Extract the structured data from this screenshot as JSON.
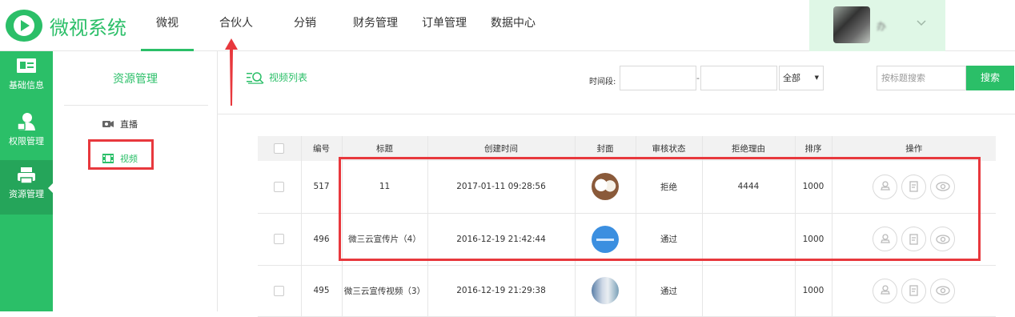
{
  "app": {
    "title": "微视系统"
  },
  "topnav": {
    "items": [
      "微视",
      "合伙人",
      "分销",
      "财务管理",
      "订单管理",
      "数据中心"
    ],
    "active_index": 0
  },
  "user": {
    "name": "办"
  },
  "sidebar": {
    "items": [
      {
        "label": "基础信息",
        "icon": "id-card-icon"
      },
      {
        "label": "权限管理",
        "icon": "user-lock-icon"
      },
      {
        "label": "资源管理",
        "icon": "printer-icon"
      }
    ],
    "active_index": 2
  },
  "subnav": {
    "title": "资源管理",
    "items": [
      {
        "label": "直播",
        "icon": "camera-icon"
      },
      {
        "label": "视频",
        "icon": "film-icon"
      }
    ],
    "active_index": 1
  },
  "page": {
    "title": "视频列表"
  },
  "filters": {
    "time_label": "时间段:",
    "dash": "-",
    "status_value": "全部",
    "search_placeholder": "按标题搜索",
    "search_button": "搜索"
  },
  "table": {
    "headers": [
      "编号",
      "标题",
      "创建时间",
      "封面",
      "审核状态",
      "拒绝理由",
      "排序",
      "操作"
    ],
    "rows": [
      {
        "id": "517",
        "title": "11",
        "created": "2017-01-11 09:28:56",
        "cover": "dogs",
        "status": "拒绝",
        "reason": "4444",
        "sort": "1000"
      },
      {
        "id": "496",
        "title": "微三云宣传片（4）",
        "created": "2016-12-19 21:42:44",
        "cover": "blue",
        "status": "通过",
        "reason": "",
        "sort": "1000"
      },
      {
        "id": "495",
        "title": "微三云宣传视频（3）",
        "created": "2016-12-19 21:29:38",
        "cover": "photo",
        "status": "通过",
        "reason": "",
        "sort": "1000"
      }
    ]
  },
  "colors": {
    "brand": "#2bbf68",
    "annotation": "#e8383d"
  }
}
